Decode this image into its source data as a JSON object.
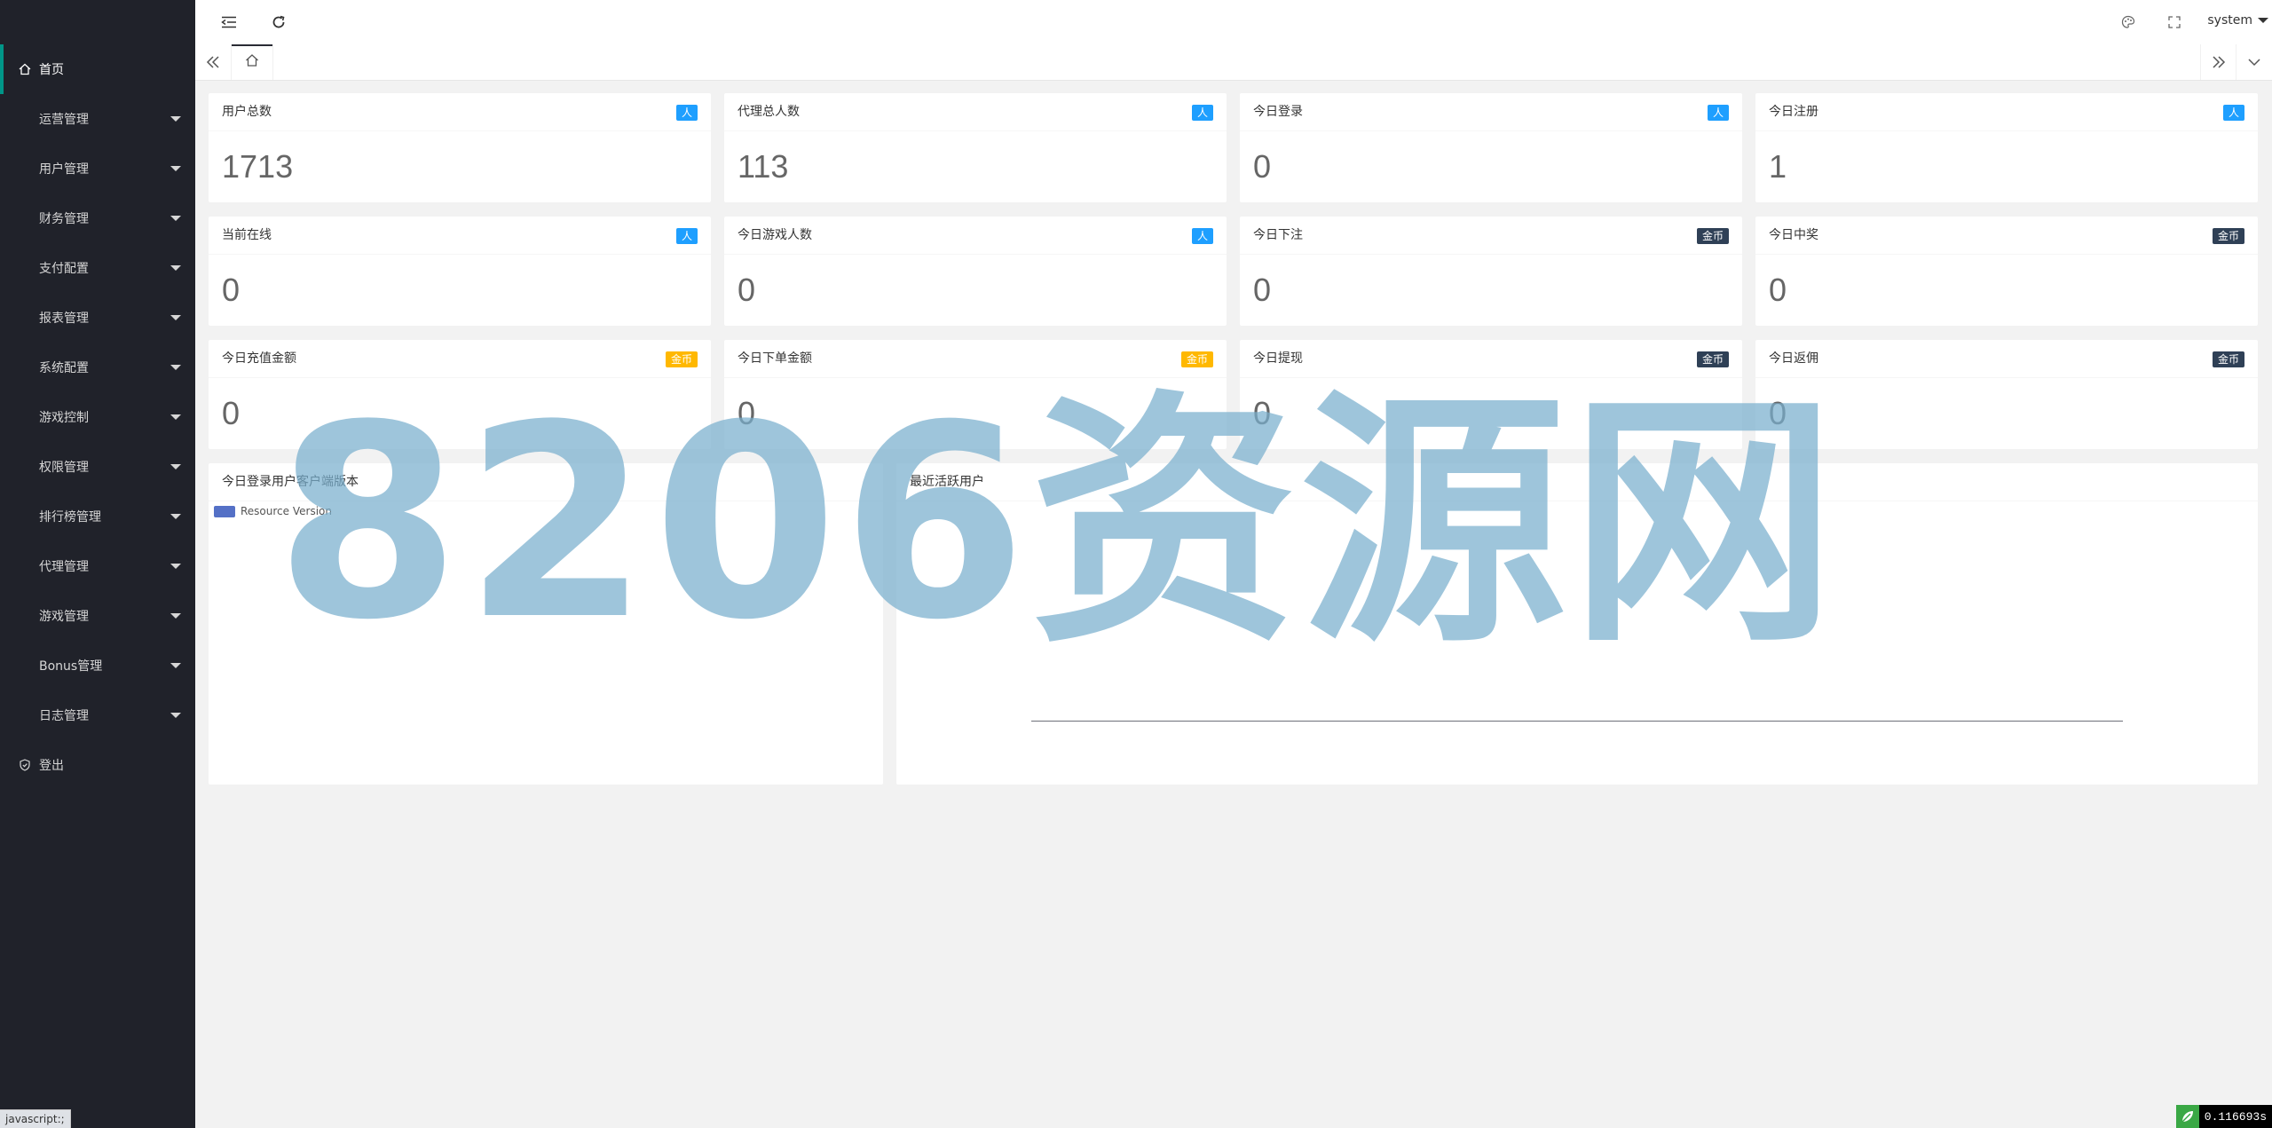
{
  "sidebar": {
    "items": [
      {
        "label": "首页",
        "icon": "home-icon"
      },
      {
        "label": "运营管理"
      },
      {
        "label": "用户管理"
      },
      {
        "label": "财务管理"
      },
      {
        "label": "支付配置"
      },
      {
        "label": "报表管理"
      },
      {
        "label": "系统配置"
      },
      {
        "label": "游戏控制"
      },
      {
        "label": "权限管理"
      },
      {
        "label": "排行榜管理"
      },
      {
        "label": "代理管理"
      },
      {
        "label": "游戏管理"
      },
      {
        "label": "Bonus管理"
      },
      {
        "label": "日志管理"
      },
      {
        "label": "登出",
        "icon": "logout-shield-icon"
      }
    ]
  },
  "header": {
    "user": "system",
    "icons": [
      "menu-collapse-icon",
      "refresh-icon",
      "theme-palette-icon",
      "fullscreen-icon"
    ]
  },
  "tabs": {
    "left_icon": "double-chevron-left-icon",
    "home_icon": "home-icon",
    "right_icon": "double-chevron-right-icon",
    "menu_icon": "chevron-down-icon"
  },
  "stats": [
    {
      "label": "用户总数",
      "badge": "人",
      "badge_color": "#1e9fff",
      "value": "1713"
    },
    {
      "label": "代理总人数",
      "badge": "人",
      "badge_color": "#1e9fff",
      "value": "113"
    },
    {
      "label": "今日登录",
      "badge": "人",
      "badge_color": "#1e9fff",
      "value": "0"
    },
    {
      "label": "今日注册",
      "badge": "人",
      "badge_color": "#1e9fff",
      "value": "1"
    },
    {
      "label": "当前在线",
      "badge": "人",
      "badge_color": "#1e9fff",
      "value": "0"
    },
    {
      "label": "今日游戏人数",
      "badge": "人",
      "badge_color": "#1e9fff",
      "value": "0"
    },
    {
      "label": "今日下注",
      "badge": "金币",
      "badge_color": "#2f4056",
      "value": "0"
    },
    {
      "label": "今日中奖",
      "badge": "金币",
      "badge_color": "#2f4056",
      "value": "0"
    },
    {
      "label": "今日充值金额",
      "badge": "金币",
      "badge_color": "#ffb800",
      "value": "0"
    },
    {
      "label": "今日下单金额",
      "badge": "金币",
      "badge_color": "#ffb800",
      "value": "0"
    },
    {
      "label": "今日提现",
      "badge": "金币",
      "badge_color": "#2f4056",
      "value": "0"
    },
    {
      "label": "今日返佣",
      "badge": "金币",
      "badge_color": "#2f4056",
      "value": "0"
    }
  ],
  "charts": {
    "login_versions": {
      "title": "今日登录用户客户端版本",
      "legend": "Resource Version"
    },
    "active_users": {
      "title": "最近活跃用户"
    }
  },
  "watermark": "8206资源网",
  "status": {
    "link_preview": "javascript:;",
    "timer": "0.116693s"
  }
}
